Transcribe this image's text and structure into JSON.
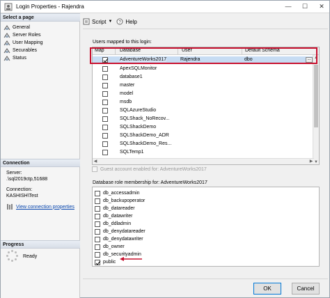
{
  "window": {
    "title": "Login Properties - Rajendra",
    "controls": {
      "minimize": "—",
      "maximize": "☐",
      "close": "✕"
    }
  },
  "left_panel": {
    "select_page_header": "Select a page",
    "pages": [
      {
        "label": "General",
        "icon": "page-icon"
      },
      {
        "label": "Server Roles",
        "icon": "page-icon"
      },
      {
        "label": "User Mapping",
        "icon": "page-icon"
      },
      {
        "label": "Securables",
        "icon": "page-icon"
      },
      {
        "label": "Status",
        "icon": "page-icon"
      }
    ],
    "connection_header": "Connection",
    "server_label": "Server:",
    "server_value": ".\\sql2019ctp,51688",
    "connection_label": "Connection:",
    "connection_value": "KASHISH\\Test",
    "view_connection_link": "View connection properties",
    "progress_header": "Progress",
    "progress_status": "Ready"
  },
  "toolbar": {
    "script_label": "Script",
    "help_label": "Help"
  },
  "users_mapped": {
    "label": "Users mapped to this login:",
    "columns": [
      "Map",
      "Database",
      "User",
      "Default Schema"
    ],
    "rows": [
      {
        "map": true,
        "database": "AdventureWorks2017",
        "user": "Rajendra",
        "schema": "dbo",
        "selected": true
      },
      {
        "map": false,
        "database": "ApexSQLMonitor",
        "user": "",
        "schema": ""
      },
      {
        "map": false,
        "database": "database1",
        "user": "",
        "schema": ""
      },
      {
        "map": false,
        "database": "master",
        "user": "",
        "schema": ""
      },
      {
        "map": false,
        "database": "model",
        "user": "",
        "schema": ""
      },
      {
        "map": false,
        "database": "msdb",
        "user": "",
        "schema": ""
      },
      {
        "map": false,
        "database": "SQLAzureStudio",
        "user": "",
        "schema": ""
      },
      {
        "map": false,
        "database": "SQLShack_NoRecov...",
        "user": "",
        "schema": ""
      },
      {
        "map": false,
        "database": "SQLShackDemo",
        "user": "",
        "schema": ""
      },
      {
        "map": false,
        "database": "SQLShackDemo_ADR",
        "user": "",
        "schema": ""
      },
      {
        "map": false,
        "database": "SQLShackDemo_Res...",
        "user": "",
        "schema": ""
      },
      {
        "map": false,
        "database": "SQLTemp1",
        "user": "",
        "schema": ""
      }
    ],
    "ellipsis": "..."
  },
  "guest": {
    "label": "Guest account enabled for: AdventureWorks2017"
  },
  "roles": {
    "label": "Database role membership for: AdventureWorks2017",
    "items": [
      {
        "name": "db_accessadmin",
        "checked": false
      },
      {
        "name": "db_backupoperator",
        "checked": false
      },
      {
        "name": "db_datareader",
        "checked": false
      },
      {
        "name": "db_datawriter",
        "checked": false
      },
      {
        "name": "db_ddladmin",
        "checked": false
      },
      {
        "name": "db_denydatareader",
        "checked": false
      },
      {
        "name": "db_denydatawriter",
        "checked": false
      },
      {
        "name": "db_owner",
        "checked": false
      },
      {
        "name": "db_securityadmin",
        "checked": false
      },
      {
        "name": "public",
        "checked": true
      }
    ]
  },
  "buttons": {
    "ok": "OK",
    "cancel": "Cancel"
  },
  "colors": {
    "highlight_box": "#c8102e",
    "selected_row": "#c7dcf3",
    "link": "#0645ad"
  }
}
